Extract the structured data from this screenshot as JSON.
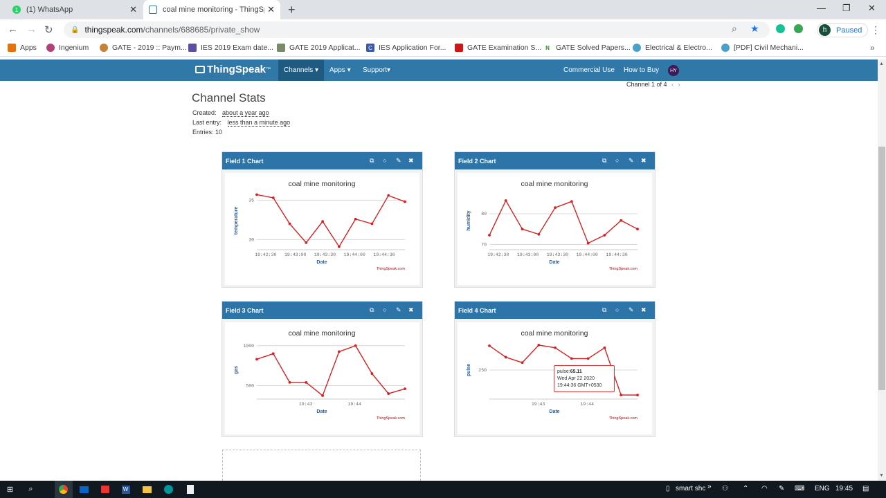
{
  "browser": {
    "tabs": [
      {
        "title": "(1) WhatsApp",
        "badge": "1"
      },
      {
        "title": "coal mine monitoring - ThingSpe"
      }
    ],
    "url_host": "thingspeak.com",
    "url_path": "/channels/688685/private_show",
    "profile_initial": "h",
    "profile_status": "Paused",
    "bookmarks": [
      "Apps",
      "Ingenium",
      "GATE - 2019 :: Paym...",
      "IES 2019 Exam date...",
      "GATE 2019 Applicat...",
      "IES Application For...",
      "GATE Examination S...",
      "GATE Solved Papers...",
      "Electrical & Electro...",
      "[PDF] Civil Mechani..."
    ]
  },
  "site": {
    "logo": "ThingSpeak",
    "logo_tm": "™",
    "menu": {
      "channels": "Channels ▾",
      "apps": "Apps ▾",
      "support": "Support▾",
      "commercial": "Commercial Use",
      "how_to_buy": "How to Buy"
    },
    "avatar": "HY"
  },
  "channel": {
    "pager": "Channel 1 of 4",
    "stats_title": "Channel Stats",
    "created_label": "Created:",
    "created_value": "about a year ago",
    "last_entry_label": "Last entry:",
    "last_entry_value": "less than a minute ago",
    "entries": "Entries: 10"
  },
  "panels": [
    {
      "title": "Field 1 Chart"
    },
    {
      "title": "Field 2 Chart"
    },
    {
      "title": "Field 3 Chart"
    },
    {
      "title": "Field 4 Chart"
    }
  ],
  "tooltip": {
    "label": "pulse:",
    "value": "65.11",
    "date": "Wed Apr 22 2020",
    "time": "19:44:36 GMT+0530"
  },
  "chart_data": [
    {
      "type": "line",
      "title": "coal mine monitoring",
      "xlabel": "Date",
      "ylabel": "temperature",
      "x_ticks": [
        "19:42:30",
        "19:43:00",
        "19:43:30",
        "19:44:00",
        "19:44:30"
      ],
      "y_ticks": [
        30,
        35
      ],
      "ylim": [
        28.8,
        36
      ],
      "color": "#d62020",
      "credit": "ThingSpeak.com",
      "values": [
        35.7,
        35.3,
        32.0,
        29.6,
        32.3,
        29.1,
        32.6,
        32.0,
        35.6,
        34.8
      ]
    },
    {
      "type": "line",
      "title": "coal mine monitoring",
      "xlabel": "Date",
      "ylabel": "humidity",
      "x_ticks": [
        "19:42:30",
        "19:43:00",
        "19:43:30",
        "19:44:00",
        "19:44:30"
      ],
      "y_ticks": [
        70,
        80
      ],
      "ylim": [
        68.5,
        87
      ],
      "color": "#d62020",
      "credit": "ThingSpeak.com",
      "values": [
        73.0,
        84.3,
        75.0,
        73.3,
        82.0,
        84.0,
        70.4,
        73.0,
        77.8,
        75.0
      ]
    },
    {
      "type": "line",
      "title": "coal mine monitoring",
      "xlabel": "Date",
      "ylabel": "gas",
      "x_ticks": [
        "19:43",
        "19:44"
      ],
      "y_ticks": [
        500,
        1000
      ],
      "ylim": [
        340,
        1050
      ],
      "color": "#d62020",
      "credit": "ThingSpeak.com",
      "values": [
        830,
        900,
        540,
        540,
        375,
        925,
        1000,
        650,
        400,
        460
      ]
    },
    {
      "type": "line",
      "title": "coal mine monitoring",
      "xlabel": "Date",
      "ylabel": "pulse",
      "x_ticks": [
        "19:43",
        "19:44"
      ],
      "y_ticks": [
        250
      ],
      "ylim": [
        40,
        460
      ],
      "color": "#d62020",
      "credit": "ThingSpeak.com",
      "values": [
        430,
        345,
        305,
        435,
        415,
        335,
        335,
        415,
        65.11,
        65
      ]
    }
  ],
  "taskbar": {
    "app_label": "smart shc",
    "lang": "ENG",
    "time": "19:45"
  }
}
